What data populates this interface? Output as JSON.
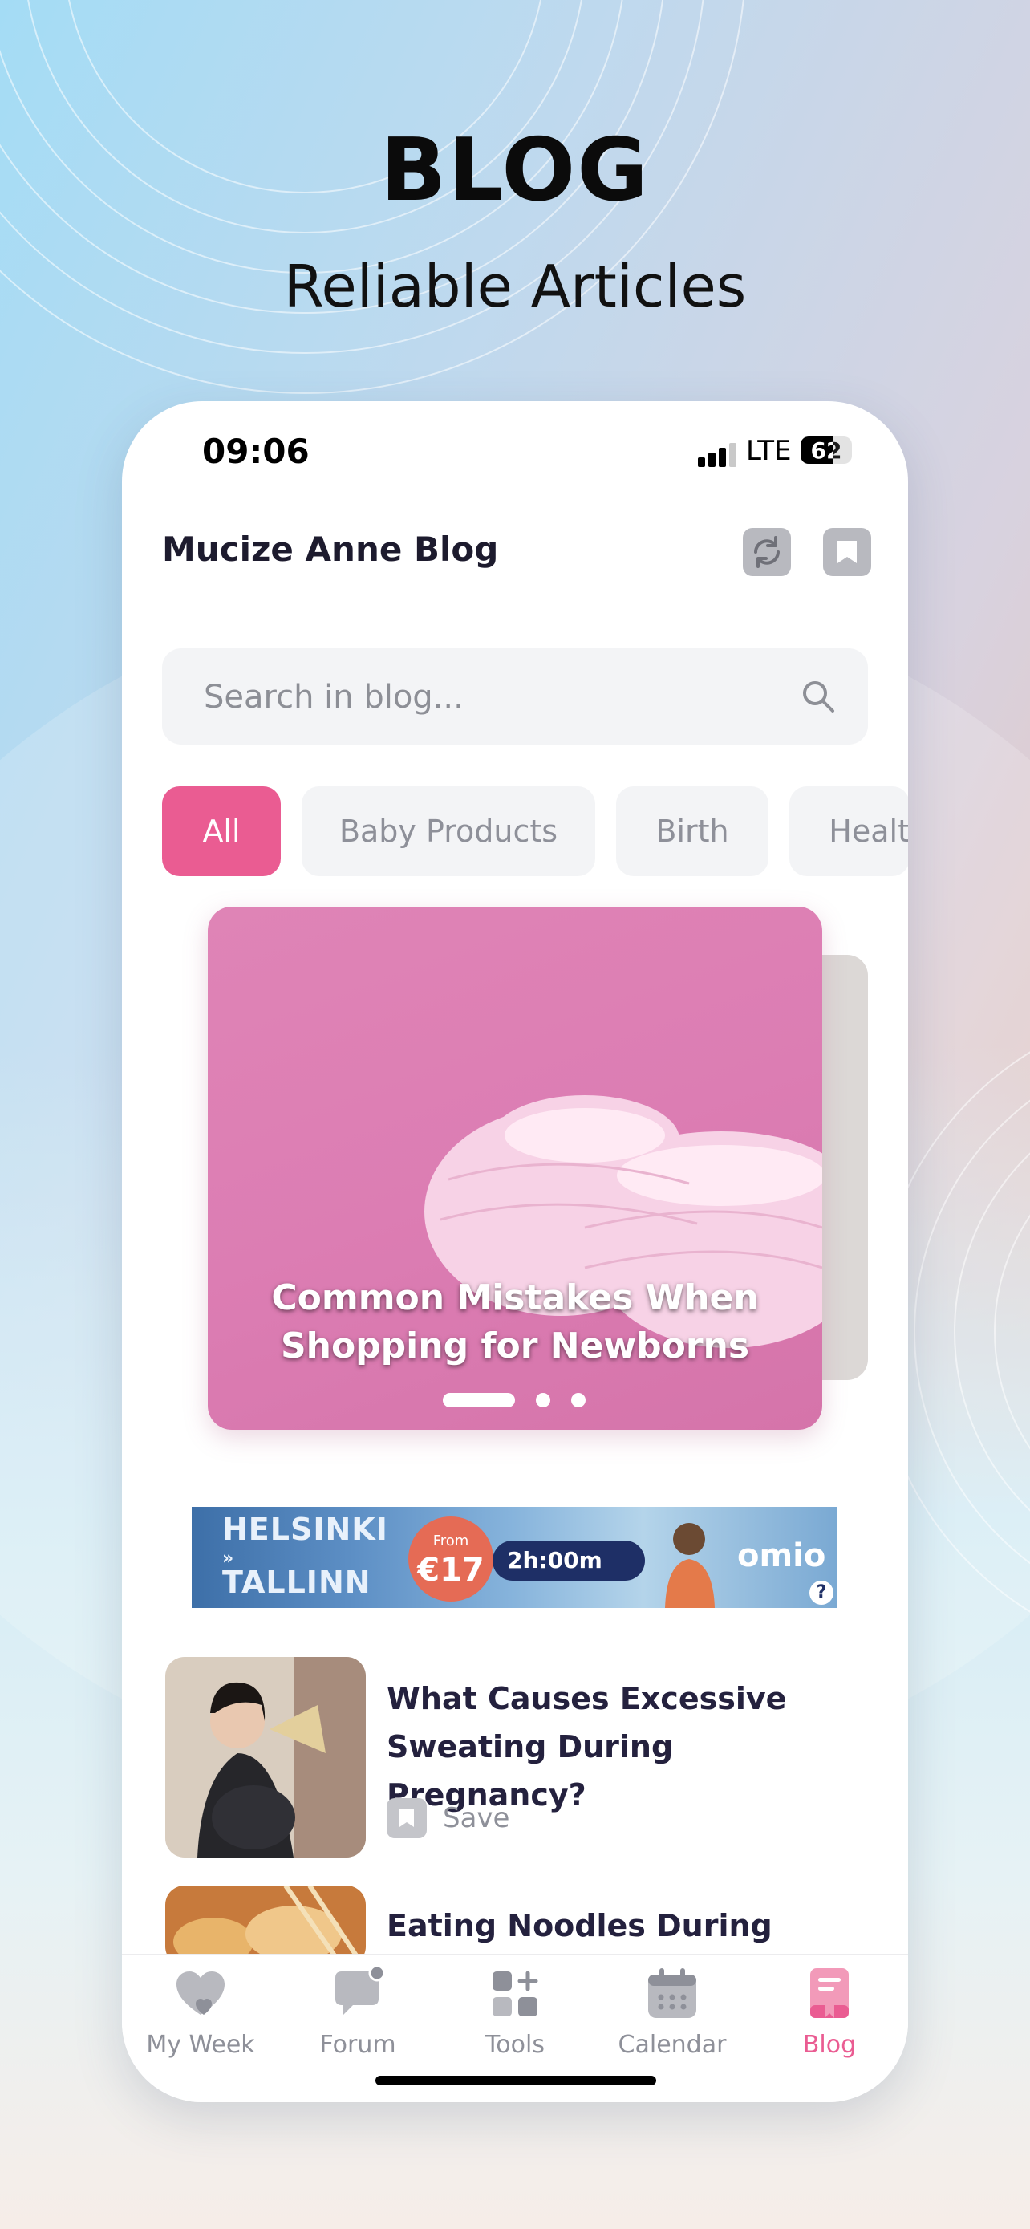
{
  "hero": {
    "title": "BLOG",
    "subtitle": "Reliable Articles"
  },
  "status_bar": {
    "time": "09:06",
    "network": "LTE",
    "battery_percent": "62",
    "battery_level": 0.62
  },
  "header": {
    "title": "Mucize Anne Blog",
    "refresh_icon": "refresh-icon",
    "bookmark_icon": "bookmark-icon"
  },
  "search": {
    "placeholder": "Search in blog...",
    "value": "",
    "icon": "search-icon"
  },
  "categories": [
    {
      "label": "All",
      "active": true
    },
    {
      "label": "Baby Products",
      "active": false
    },
    {
      "label": "Birth",
      "active": false
    },
    {
      "label": "Healt",
      "active": false
    }
  ],
  "featured": {
    "title": "Common Mistakes When Shopping for Newborns",
    "slides": 3,
    "active_slide": 1
  },
  "ad": {
    "city_from": "HELSINKI",
    "city_to": "TALLINN",
    "price_prefix": "From",
    "price": "€17",
    "duration": "2h:00m",
    "brand": "omio",
    "info": "?"
  },
  "articles": [
    {
      "title": "What Causes Excessive Sweating During Pregnancy?",
      "save_label": "Save"
    },
    {
      "title": "Eating Noodles During"
    }
  ],
  "tabbar": {
    "items": [
      {
        "label": "My Week",
        "icon": "heart-icon",
        "active": false
      },
      {
        "label": "Forum",
        "icon": "chat-bubble-icon",
        "active": false
      },
      {
        "label": "Tools",
        "icon": "tools-grid-icon",
        "active": false
      },
      {
        "label": "Calendar",
        "icon": "calendar-icon",
        "active": false
      },
      {
        "label": "Blog",
        "icon": "blog-book-icon",
        "active": true
      }
    ]
  },
  "colors": {
    "accent": "#ea5c92",
    "chip_bg": "#f3f4f6",
    "muted_text": "#8e9099",
    "title_text": "#24213e"
  }
}
